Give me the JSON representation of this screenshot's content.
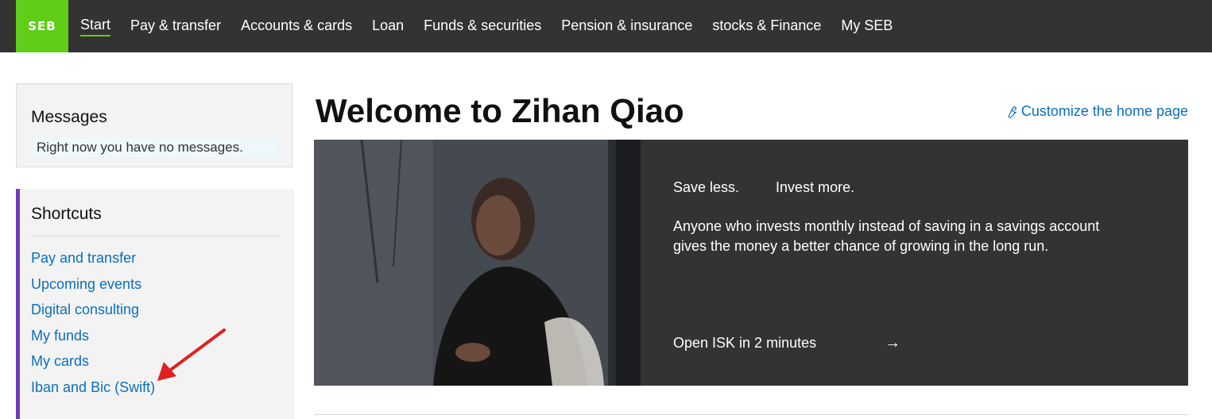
{
  "brand": {
    "logo_text": "SEB",
    "accent": "#60cd18",
    "shortcut_accent": "#6c3cbf",
    "link_color": "#0a6fbf"
  },
  "nav": {
    "items": [
      {
        "label": "Start",
        "active": true
      },
      {
        "label": "Pay & transfer"
      },
      {
        "label": "Accounts & cards"
      },
      {
        "label": "Loan"
      },
      {
        "label": "Funds & securities"
      },
      {
        "label": "Pension & insurance"
      },
      {
        "label": "stocks & Finance"
      },
      {
        "label": "My SEB"
      }
    ]
  },
  "messages": {
    "title": "Messages",
    "empty_text": "Right now you have no messages."
  },
  "shortcuts": {
    "title": "Shortcuts",
    "items": [
      {
        "label": "Pay and transfer"
      },
      {
        "label": "Upcoming events"
      },
      {
        "label": "Digital consulting"
      },
      {
        "label": "My funds"
      },
      {
        "label": "My cards"
      },
      {
        "label": "Iban and Bic (Swift)"
      }
    ]
  },
  "main": {
    "welcome": "Welcome to Zihan Qiao",
    "customize_label": "Customize the home page",
    "customize_icon": "wrench-icon"
  },
  "hero": {
    "tagline_1": "Save less.",
    "tagline_2": "Invest more.",
    "body": "Anyone who invests monthly instead of saving in a savings account gives the money a better chance of growing in the long run.",
    "cta_label": "Open ISK in 2 minutes",
    "cta_icon": "arrow-right-icon"
  }
}
